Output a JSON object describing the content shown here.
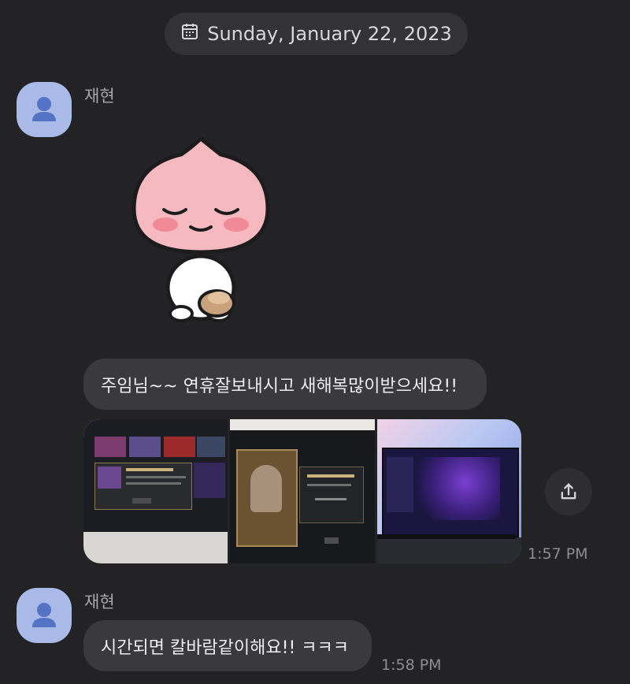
{
  "date_divider": {
    "label": "Sunday, January 22, 2023",
    "icon": "calendar-icon"
  },
  "messages": [
    {
      "sender": "재현",
      "sticker": "peach-character-sticker",
      "text": "주임님~~ 연휴잘보내시고 새해복많이받으세요!!",
      "photos": [
        "game-store-screenshot-photo",
        "champion-skin-purchase-photo",
        "game-client-monitor-photo"
      ],
      "time": "1:57 PM"
    },
    {
      "sender": "재현",
      "text": "시간되면 칼바람같이해요!! ㅋㅋㅋ",
      "time": "1:58 PM"
    }
  ],
  "colors": {
    "background": "#232325",
    "bubble": "#3a3a3d",
    "avatar": "#a9b9e8"
  }
}
